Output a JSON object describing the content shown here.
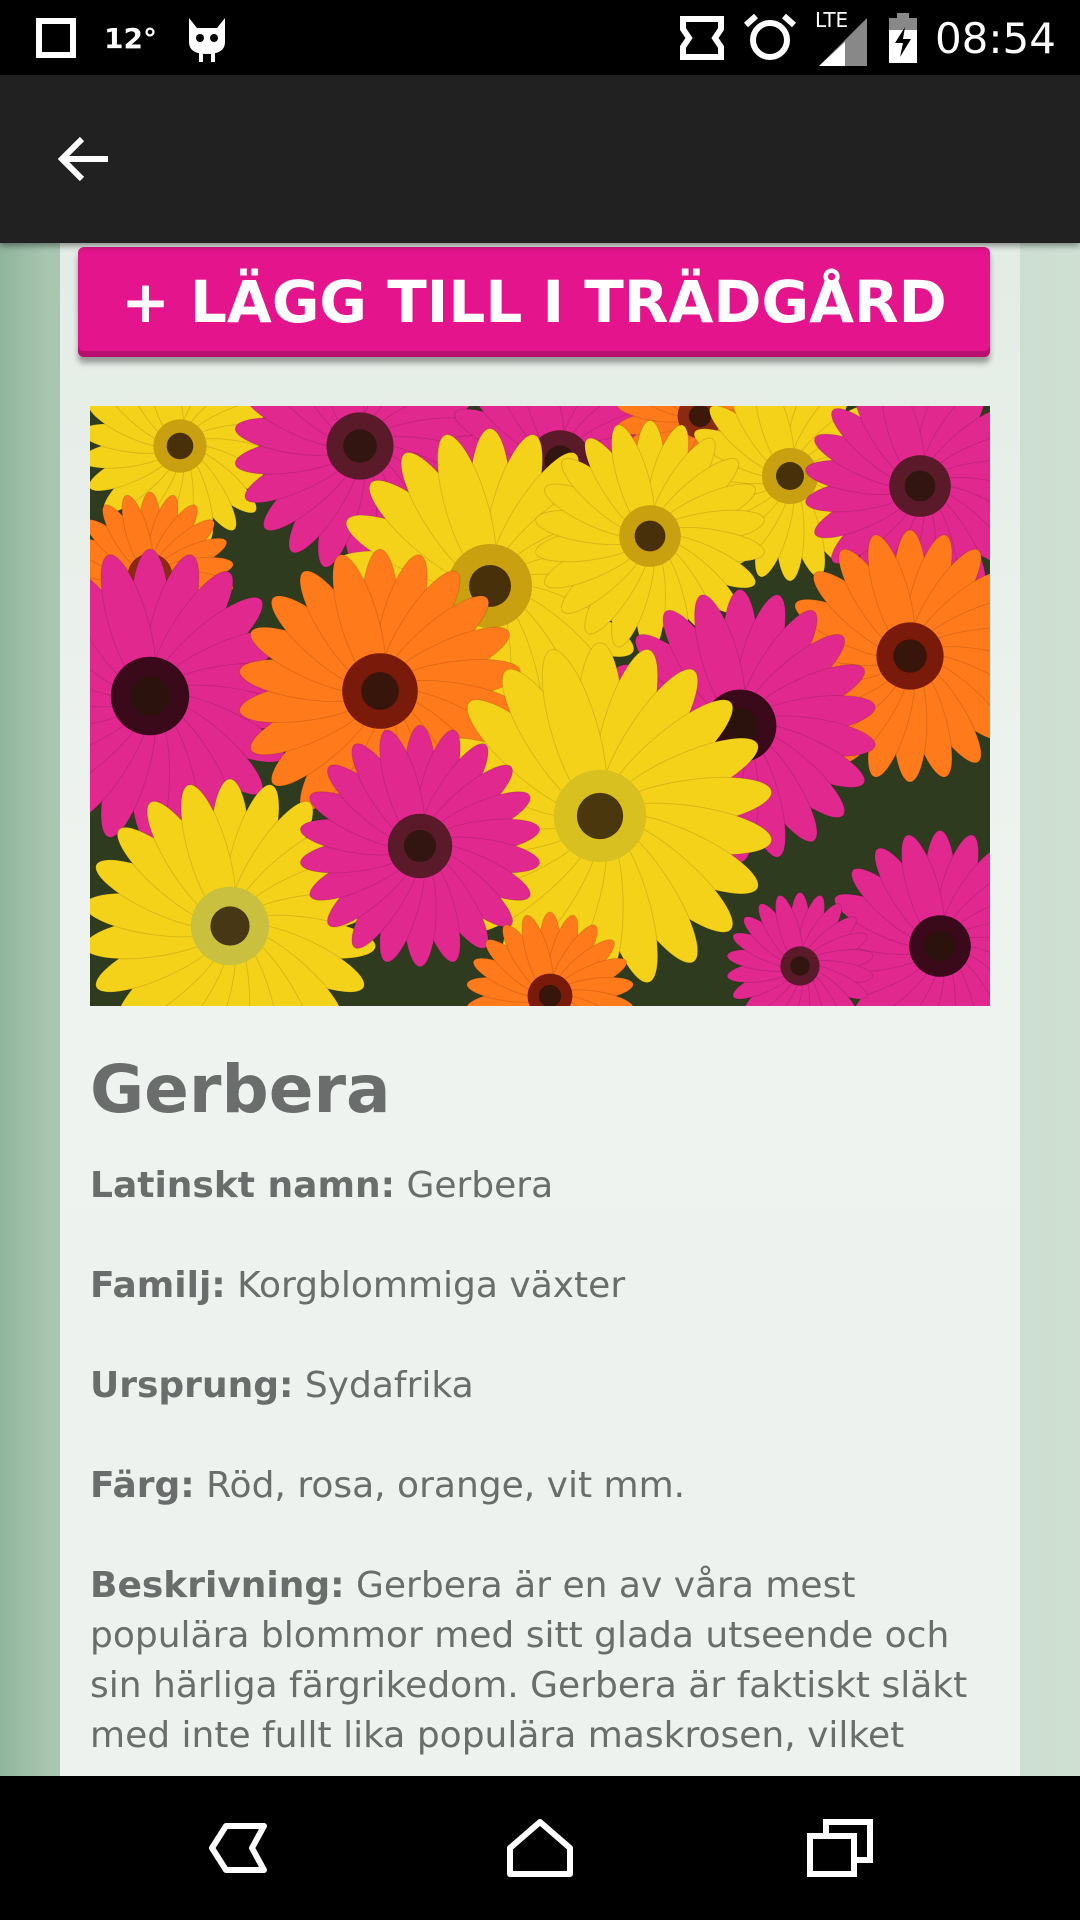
{
  "status_bar": {
    "temperature": "12°",
    "network": "LTE",
    "time": "08:54",
    "icons": [
      "square-notification-icon",
      "cyanogen-mascot-icon",
      "nfc-icon",
      "alarm-icon",
      "signal-icon",
      "battery-charging-icon"
    ]
  },
  "app_bar": {
    "back_icon": "arrow-left-icon"
  },
  "add_button": {
    "label": "+ LÄGG TILL I TRÄDGÅRD",
    "color": "#e4148c"
  },
  "plant": {
    "name": "Gerbera",
    "photo_subject": "gerbera-flowers-photo",
    "fields": [
      {
        "key": "Latinskt namn:",
        "value": "Gerbera"
      },
      {
        "key": "Familj:",
        "value": "Korgblommiga växter"
      },
      {
        "key": "Ursprung:",
        "value": "Sydafrika"
      },
      {
        "key": "Färg:",
        "value": "Röd, rosa, orange, vit mm."
      },
      {
        "key": "Beskrivning:",
        "value": "Gerbera är en av våra mest populära blommor med sitt glada utseende och sin härliga färgrikedom. Gerbera är faktiskt släkt med inte fullt lika populära maskrosen, vilket"
      }
    ]
  },
  "nav_bar": {
    "back_icon": "nav-back-icon",
    "home_icon": "nav-home-icon",
    "recents_icon": "nav-recents-icon"
  }
}
